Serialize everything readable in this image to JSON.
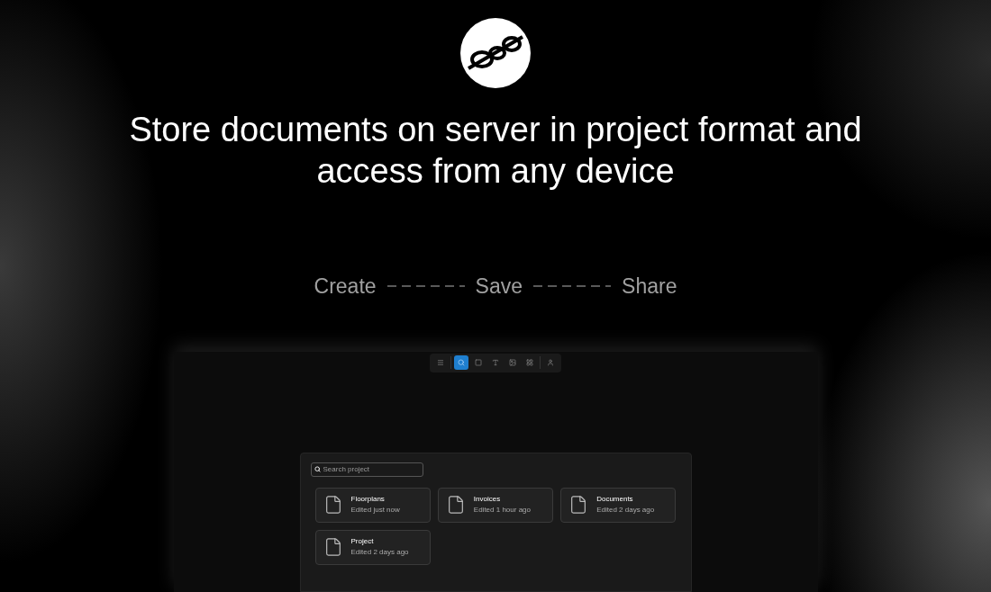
{
  "headline": "Store documents on server in project format and access from any device",
  "steps": [
    "Create",
    "Save",
    "Share"
  ],
  "toolbar": [
    {
      "kind": "menu",
      "selected": false
    },
    {
      "kind": "search",
      "selected": true
    },
    {
      "kind": "square",
      "selected": false
    },
    {
      "kind": "text",
      "selected": false
    },
    {
      "kind": "image",
      "selected": false
    },
    {
      "kind": "grid",
      "selected": false
    },
    {
      "kind": "user",
      "selected": false
    }
  ],
  "search": {
    "placeholder": "Search project"
  },
  "projects": [
    {
      "name": "Floorplans",
      "edited": "Edited just now"
    },
    {
      "name": "Invoices",
      "edited": "Edited 1 hour ago"
    },
    {
      "name": "Documents",
      "edited": "Edited 2 days ago"
    },
    {
      "name": "Project",
      "edited": "Edited 2 days ago"
    }
  ]
}
